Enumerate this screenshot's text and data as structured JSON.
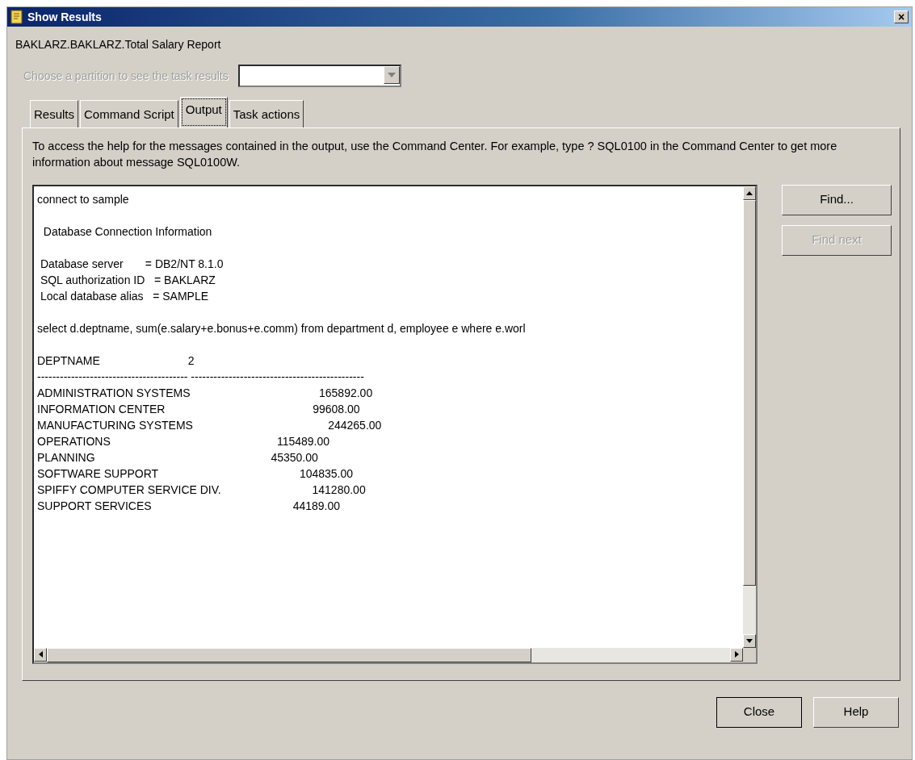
{
  "window": {
    "title": "Show Results",
    "close_glyph": "×"
  },
  "subtitle": "BAKLARZ.BAKLARZ.Total Salary Report",
  "partition": {
    "label": "Choose a partition to see the task results",
    "disabled": true
  },
  "tabs": [
    {
      "label": "Results",
      "selected": false
    },
    {
      "label": "Command Script",
      "selected": false
    },
    {
      "label": "Output",
      "selected": true
    },
    {
      "label": "Task actions",
      "selected": false
    }
  ],
  "help_text": "To access the help for the messages contained in the output, use the Command Center.  For example, type ? SQL0100 in the Command Center to get more information about message SQL0100W.",
  "output_blocks": [
    [
      "connect to sample"
    ],
    [
      "  Database Connection Information"
    ],
    [
      " Database server       = DB2/NT 8.1.0",
      " SQL authorization ID   = BAKLARZ",
      " Local database alias   = SAMPLE"
    ],
    [
      "select d.deptname, sum(e.salary+e.bonus+e.comm) from department d, employee e where e.worl"
    ],
    [
      "DEPTNAME                            2",
      "---------------------------------------- ----------------------------------------------",
      "ADMINISTRATION SYSTEMS                                         165892.00",
      "INFORMATION CENTER                                               99608.00",
      "MANUFACTURING SYSTEMS                                           244265.00",
      "OPERATIONS                                                     115489.00",
      "PLANNING                                                        45350.00",
      "SOFTWARE SUPPORT                                             104835.00",
      "SPIFFY COMPUTER SERVICE DIV.                             141280.00",
      "SUPPORT SERVICES                                             44189.00"
    ]
  ],
  "side_buttons": [
    {
      "label": "Find...",
      "disabled": false
    },
    {
      "label": "Find next",
      "disabled": true
    }
  ],
  "footer_buttons": [
    {
      "label": "Close",
      "selected": true
    },
    {
      "label": "Help",
      "selected": false
    }
  ]
}
